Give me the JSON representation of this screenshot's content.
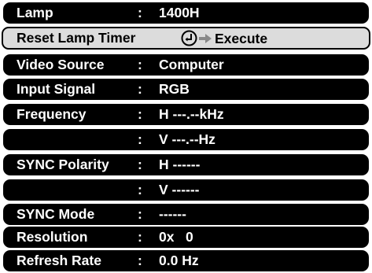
{
  "rows": [
    {
      "label": "Lamp",
      "colon": ":",
      "value": "1400H"
    },
    {
      "label": "Reset Lamp Timer",
      "action": "Execute"
    },
    {
      "label": "Video Source",
      "colon": ":",
      "value": "Computer"
    },
    {
      "label": "Input Signal",
      "colon": ":",
      "value": "RGB"
    },
    {
      "label": "Frequency",
      "colon": ":",
      "value": "H ---.--kHz"
    },
    {
      "label": "",
      "colon": ":",
      "value": "V ---.--Hz"
    },
    {
      "label": "SYNC Polarity",
      "colon": ":",
      "value": "H ------"
    },
    {
      "label": "",
      "colon": ":",
      "value": "V ------"
    },
    {
      "label": "SYNC Mode",
      "colon": ":",
      "value": "------"
    },
    {
      "label": "Resolution",
      "colon": ":",
      "value": "0x   0"
    },
    {
      "label": "Refresh Rate",
      "colon": ":",
      "value": "0.0 Hz"
    }
  ],
  "icons": {
    "enter": "enter-key-icon",
    "arrow": "arrow-right-icon"
  },
  "colors": {
    "row_bg": "#000000",
    "row_text": "#ffffff",
    "selected_bg": "#dcdcdc",
    "selected_text": "#000000"
  }
}
